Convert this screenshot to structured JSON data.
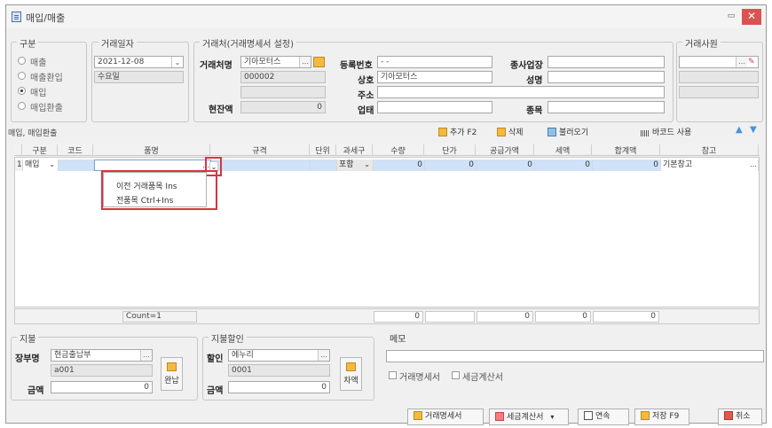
{
  "window": {
    "title": "매입/매출",
    "minimize": "▭",
    "close": "✕"
  },
  "kind": {
    "legend": "구분",
    "options": [
      {
        "label": "매출",
        "selected": false
      },
      {
        "label": "매출환입",
        "selected": false
      },
      {
        "label": "매입",
        "selected": true
      },
      {
        "label": "매입환출",
        "selected": false
      }
    ]
  },
  "date": {
    "legend": "거래일자",
    "value": "2021-12-08",
    "weekday": "수요일"
  },
  "partner": {
    "legend": "거래처(거래명세서 설정)",
    "name_label": "거래처명",
    "name_value": "기아모터스",
    "code": "000002",
    "balance_label": "현잔액",
    "balance_value": "0",
    "regno_label": "등록번호",
    "regno_value": "- -",
    "company_label": "상호",
    "company_value": "기아모터스",
    "address_label": "주소",
    "business_label": "업태",
    "branch_label": "종사업장",
    "rep_label": "성명",
    "item_label": "종목"
  },
  "staff": {
    "legend": "거래사원"
  },
  "grid": {
    "section_title": "매입, 매입환출",
    "toolbar": {
      "add": "추가 F2",
      "delete": "삭제",
      "load": "불러오기",
      "barcode": "바코드 사용"
    },
    "columns": [
      "구분",
      "코드",
      "품명",
      "규격",
      "단위",
      "과세구",
      "수량",
      "단가",
      "공급가액",
      "세액",
      "합계액",
      "참고"
    ],
    "rows": [
      {
        "no": "1",
        "kind": "매입",
        "code": "",
        "name": "",
        "spec": "",
        "unit": "",
        "tax": "포함",
        "qty": "0",
        "price": "0",
        "supply": "0",
        "vat": "0",
        "total": "0",
        "note": "기본창고"
      }
    ],
    "footer": {
      "count": "Count=1",
      "qty_sum": "0",
      "supply_sum": "0",
      "vat_sum": "0",
      "total_sum": "0"
    }
  },
  "context_menu": {
    "items": [
      {
        "label": "이전 거래품목",
        "shortcut": "Ins"
      },
      {
        "label": "전품목",
        "shortcut": "Ctrl+Ins"
      }
    ]
  },
  "payment": {
    "legend": "지불",
    "ledger_label": "장부명",
    "ledger_value": "현금출납부",
    "ledger_code": "a001",
    "amount_label": "금액",
    "amount_value": "0",
    "button": "완납"
  },
  "discount": {
    "legend": "지불할인",
    "label": "할인",
    "value": "에누리",
    "code": "0001",
    "amount_label": "금액",
    "amount_value": "0",
    "button": "차액"
  },
  "memo": {
    "legend": "메모",
    "checkbox_statement": "거래명세서",
    "checkbox_invoice": "세금계산서"
  },
  "buttons": {
    "statement": "거래명세서",
    "tax_invoice": "세금계산서",
    "continuous": "연속",
    "save": "저장 F9",
    "cancel": "취소"
  }
}
